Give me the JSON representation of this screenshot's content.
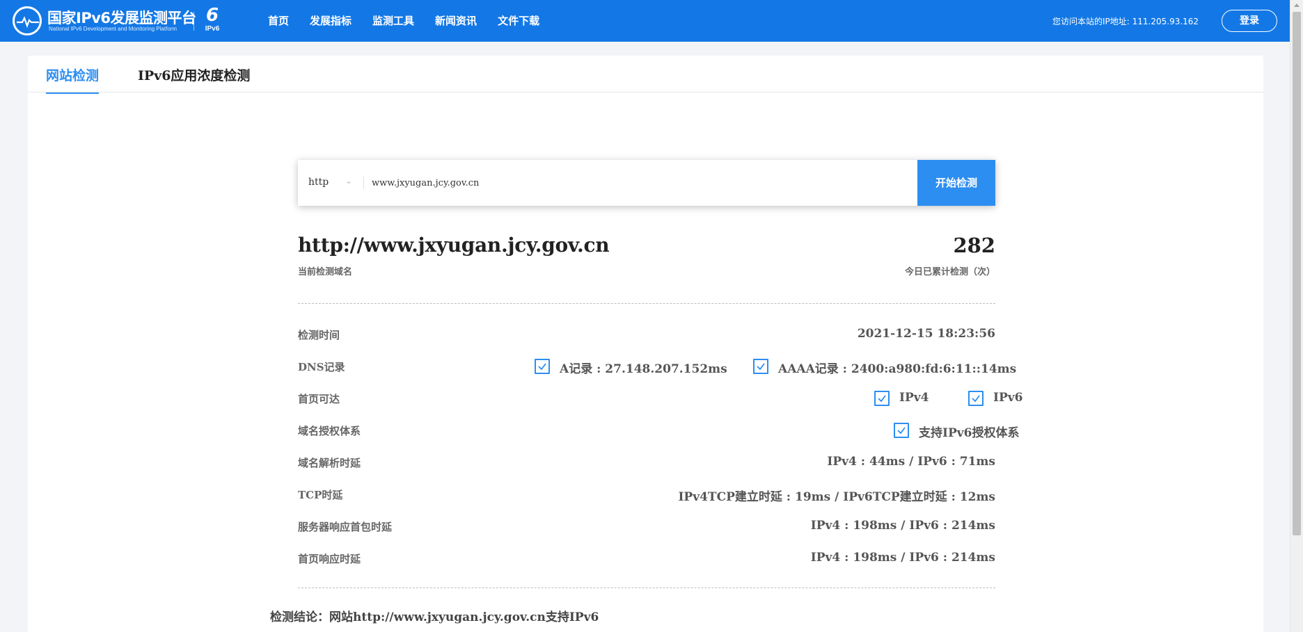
{
  "header": {
    "title_cn": "国家IPv6发展监测平台",
    "title_en": "National IPv6 Development and Monitoring Platform",
    "badge_label": "IPv6",
    "nav": [
      "首页",
      "发展指标",
      "监测工具",
      "新闻资讯",
      "文件下载"
    ],
    "ip_info": "您访问本站的IP地址: 111.205.93.162",
    "login_label": "登录"
  },
  "tabs": [
    "网站检测",
    "IPv6应用浓度检测"
  ],
  "search": {
    "protocol": "http",
    "url_value": "www.jxyugan.jcy.gov.cn",
    "button_label": "开始检测"
  },
  "summary": {
    "domain": "http://www.jxyugan.jcy.gov.cn",
    "domain_caption": "当前检测域名",
    "count": "282",
    "count_caption": "今日已累计检测（次）"
  },
  "details": {
    "check_time": {
      "label": "检测时间",
      "value": "2021-12-15 18:23:56"
    },
    "dns": {
      "label": "DNS记录",
      "a_record": "A记录 : 27.148.207.152ms",
      "aaaa_record": "AAAA记录 : 2400:a980:fd:6:11::14ms"
    },
    "homepage_reach": {
      "label": "首页可达",
      "ipv4": "IPv4",
      "ipv6": "IPv6"
    },
    "auth": {
      "label": "域名授权体系",
      "value": "支持IPv6授权体系"
    },
    "dns_latency": {
      "label": "域名解析时延",
      "value": "IPv4 : 44ms / IPv6 : 71ms"
    },
    "tcp_latency": {
      "label": "TCP时延",
      "value": "IPv4TCP建立时延 : 19ms / IPv6TCP建立时延 : 12ms"
    },
    "server_first_packet": {
      "label": "服务器响应首包时延",
      "value": "IPv4 : 198ms / IPv6 : 214ms"
    },
    "homepage_latency": {
      "label": "首页响应时延",
      "value": "IPv4 : 198ms / IPv6 : 214ms"
    }
  },
  "conclusion": "检测结论：网站http://www.jxyugan.jcy.gov.cn支持IPv6",
  "colors": {
    "primary": "#1378e6",
    "accent": "#2d8ef1"
  }
}
